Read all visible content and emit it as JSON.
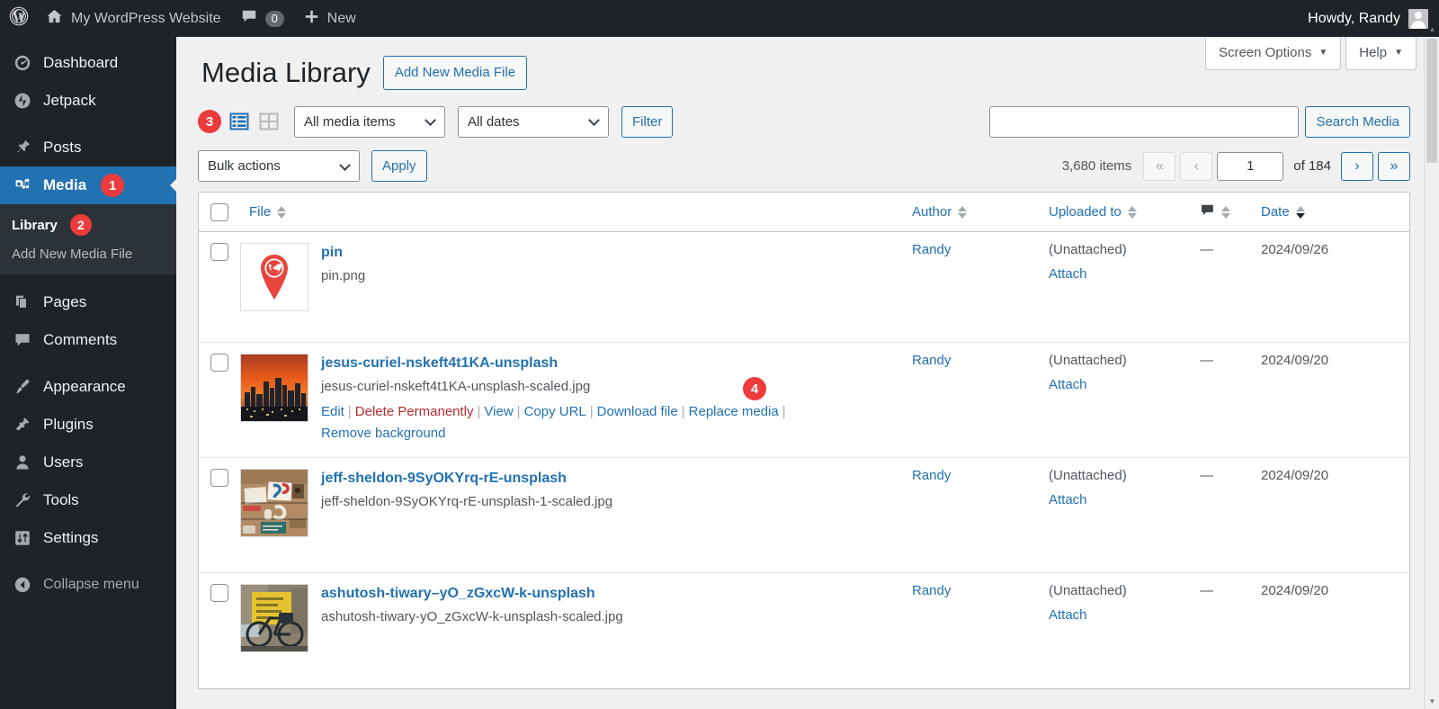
{
  "adminbar": {
    "logo_icon": "wordpress-logo-icon",
    "site_icon": "home-icon",
    "site_name": "My WordPress Website",
    "comments_icon": "comment-bubble-icon",
    "comments_count": "0",
    "new_icon": "plus-icon",
    "new_label": "New",
    "howdy": "Howdy, Randy",
    "avatar_icon": "user-avatar-icon"
  },
  "sidebar": {
    "items": [
      {
        "label": "Dashboard",
        "icon": "dashboard-gauge-icon",
        "current": false
      },
      {
        "label": "Jetpack",
        "icon": "jetpack-icon",
        "current": false
      },
      {
        "label": "Posts",
        "icon": "pin-thumbtack-icon",
        "current": false
      },
      {
        "label": "Media",
        "icon": "media-camera-music-icon",
        "current": true,
        "callout": "1"
      },
      {
        "label": "Pages",
        "icon": "pages-icon",
        "current": false
      },
      {
        "label": "Comments",
        "icon": "comment-bubble-icon",
        "current": false
      },
      {
        "label": "Appearance",
        "icon": "paintbrush-icon",
        "current": false
      },
      {
        "label": "Plugins",
        "icon": "plug-icon",
        "current": false
      },
      {
        "label": "Users",
        "icon": "user-icon",
        "current": false
      },
      {
        "label": "Tools",
        "icon": "wrench-icon",
        "current": false
      },
      {
        "label": "Settings",
        "icon": "settings-sliders-icon",
        "current": false
      }
    ],
    "submenu": [
      {
        "label": "Library",
        "current": true,
        "callout": "2"
      },
      {
        "label": "Add New Media File",
        "current": false
      }
    ],
    "collapse": {
      "label": "Collapse menu",
      "icon": "collapse-arrow-icon"
    }
  },
  "screen_meta": {
    "screen_options": "Screen Options",
    "help": "Help",
    "caret_icon": "chevron-down-icon"
  },
  "page": {
    "title": "Media Library",
    "add_new_label": "Add New Media File"
  },
  "toolbar": {
    "callout": "3",
    "list_view_icon": "list-view-icon",
    "grid_view_icon": "grid-view-icon",
    "media_filter": "All media items",
    "date_filter": "All dates",
    "filter_button": "Filter",
    "search_value": "",
    "search_placeholder": "",
    "search_button": "Search Media"
  },
  "bulknav": {
    "bulk_actions": "Bulk actions",
    "apply_button": "Apply",
    "items_count": "3,680 items",
    "first_page_icon": "«",
    "prev_page_icon": "‹",
    "current_page": "1",
    "of_label": "of 184",
    "next_page_icon": "›",
    "last_page_icon": "»"
  },
  "table": {
    "columns": {
      "file": "File",
      "author": "Author",
      "uploaded_to": "Uploaded to",
      "comments_icon": "comment-bubble-icon",
      "date": "Date"
    },
    "rows": [
      {
        "thumb": "map-pin-globe-thumbnail",
        "title": "pin",
        "filename": "pin.png",
        "actions": [],
        "author": "Randy",
        "uploaded_to": "(Unattached)",
        "attach_label": "Attach",
        "comments": "—",
        "date": "2024/09/26"
      },
      {
        "thumb": "city-skyline-sunset-thumbnail",
        "title": "jesus-curiel-nskeft4t1KA-unsplash",
        "filename": "jesus-curiel-nskeft4t1KA-unsplash-scaled.jpg",
        "actions": [
          {
            "label": "Edit",
            "style": "link"
          },
          {
            "label": "Delete Permanently",
            "style": "trash"
          },
          {
            "label": "View",
            "style": "link"
          },
          {
            "label": "Copy URL",
            "style": "link"
          },
          {
            "label": "Download file",
            "style": "link"
          },
          {
            "label": "Replace media",
            "style": "link"
          },
          {
            "label": "Remove background",
            "style": "link"
          }
        ],
        "callout": "4",
        "author": "Randy",
        "uploaded_to": "(Unattached)",
        "attach_label": "Attach",
        "comments": "—",
        "date": "2024/09/20"
      },
      {
        "thumb": "desk-workspace-thumbnail",
        "title": "jeff-sheldon-9SyOKYrq-rE-unsplash",
        "filename": "jeff-sheldon-9SyOKYrq-rE-unsplash-1-scaled.jpg",
        "actions": [],
        "author": "Randy",
        "uploaded_to": "(Unattached)",
        "attach_label": "Attach",
        "comments": "—",
        "date": "2024/09/20"
      },
      {
        "thumb": "bicycle-yellow-wall-thumbnail",
        "title": "ashutosh-tiwary–yO_zGxcW-k-unsplash",
        "filename": "ashutosh-tiwary-yO_zGxcW-k-unsplash-scaled.jpg",
        "actions": [],
        "author": "Randy",
        "uploaded_to": "(Unattached)",
        "attach_label": "Attach",
        "comments": "—",
        "date": "2024/09/20"
      }
    ]
  },
  "colors": {
    "admin_dark": "#1d2327",
    "admin_submenu": "#2c3338",
    "accent_blue": "#2271b1",
    "callout_red": "#ed3b3b",
    "trash_red": "#b32d2e",
    "content_bg": "#f0f0f1"
  }
}
